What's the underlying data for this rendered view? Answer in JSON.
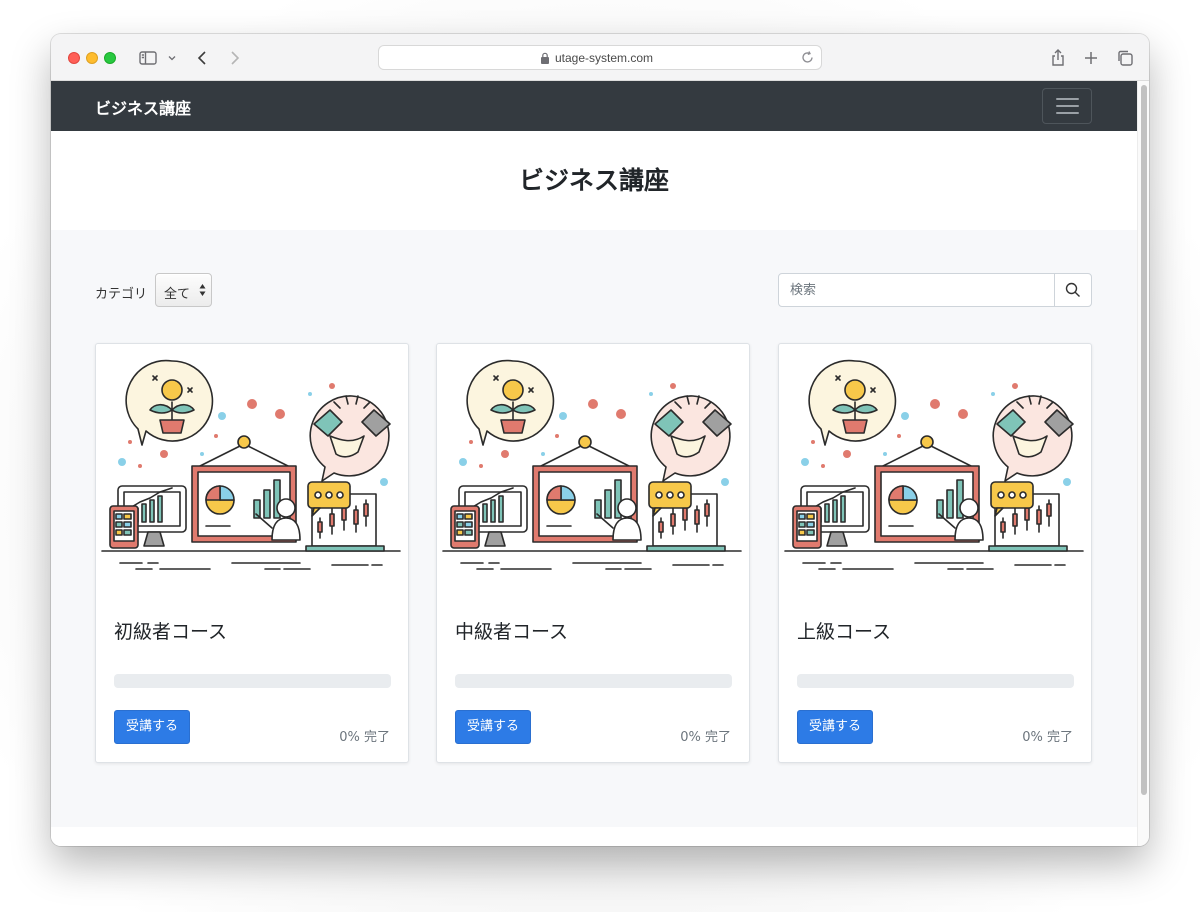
{
  "browser": {
    "url": "utage-system.com",
    "icons": [
      "sidebar-icon",
      "chevron-down-icon",
      "back-icon",
      "forward-icon",
      "lock-icon",
      "reload-icon",
      "share-icon",
      "new-tab-icon",
      "tabs-overview-icon"
    ]
  },
  "navbar": {
    "brand": "ビジネス講座",
    "toggler_icon": "hamburger-icon"
  },
  "header": {
    "title": "ビジネス講座"
  },
  "filters": {
    "category_label": "カテゴリ",
    "category_selected": "全て",
    "search_placeholder": "検索",
    "search_icon": "search-icon"
  },
  "courses": [
    {
      "title": "初級者コース",
      "button": "受講する",
      "progress_text": "0% 完了",
      "progress": 0
    },
    {
      "title": "中級者コース",
      "button": "受講する",
      "progress_text": "0% 完了",
      "progress": 0
    },
    {
      "title": "上級コース",
      "button": "受講する",
      "progress_text": "0% 完了",
      "progress": 0
    }
  ],
  "colors": {
    "navbar_bg": "#343a40",
    "button_primary": "#2d7be6",
    "page_bg": "#f7f8fa"
  }
}
